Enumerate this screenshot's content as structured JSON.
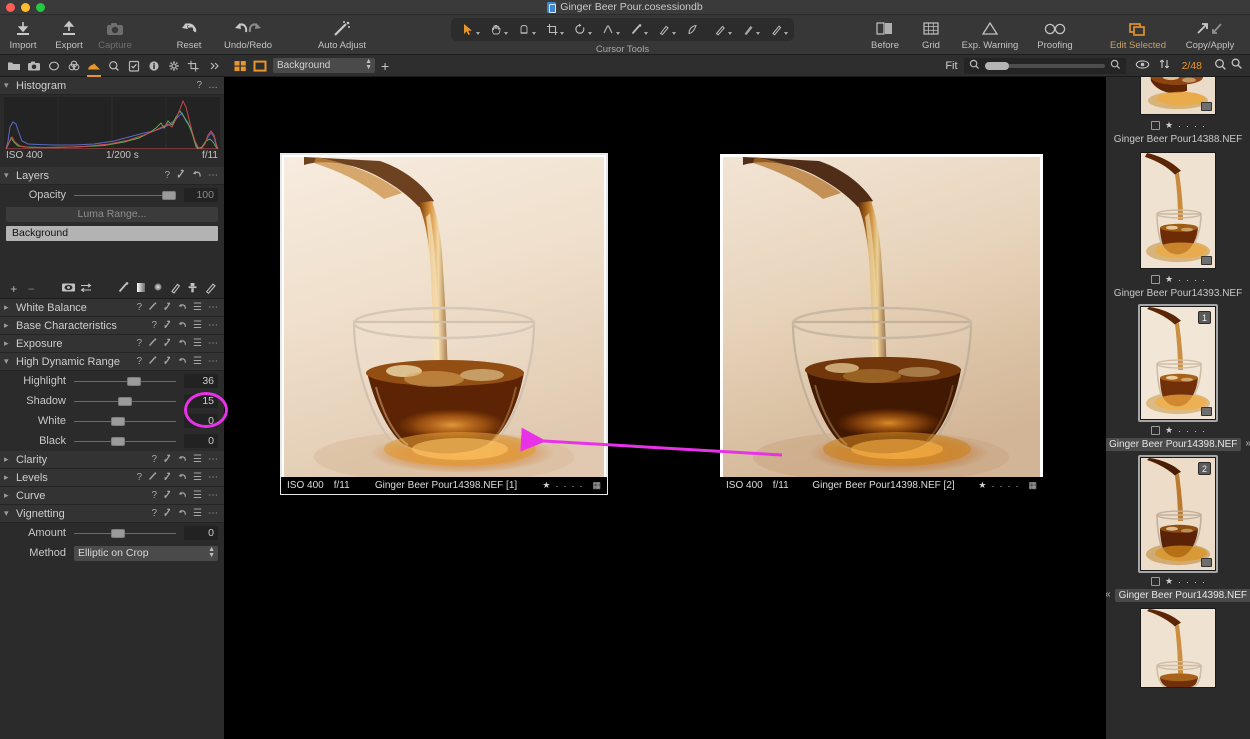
{
  "window": {
    "title": "Ginger Beer Pour.cosessiondb",
    "traffic": [
      "close",
      "minimize",
      "maximize"
    ]
  },
  "toolbar": {
    "left_items": [
      {
        "label": "Import",
        "icon": "import-icon",
        "enabled": true
      },
      {
        "label": "Export",
        "icon": "export-icon",
        "enabled": true
      },
      {
        "label": "Capture",
        "icon": "capture-camera-icon",
        "enabled": false
      }
    ],
    "history_items": [
      {
        "label": "Reset",
        "icon": "reset-icon"
      },
      {
        "label": "Undo/Redo",
        "icon": "undo-redo-icon"
      }
    ],
    "auto_adjust": {
      "label": "Auto Adjust",
      "icon": "magic-wand-icon"
    },
    "cursor_tools": {
      "label": "Cursor Tools",
      "tools": [
        {
          "name": "select-tool",
          "active": true
        },
        {
          "name": "pan-hand-tool",
          "active": false
        },
        {
          "name": "color-picker-tool",
          "active": false
        },
        {
          "name": "crop-tool",
          "active": false
        },
        {
          "name": "rotate-tool",
          "active": false
        },
        {
          "name": "keystone-tool",
          "active": false
        },
        {
          "name": "spot-removal-tool",
          "active": false
        },
        {
          "name": "heal-brush-tool",
          "active": false
        },
        {
          "name": "eraser-tool",
          "active": false
        },
        {
          "name": "draw-mask-tool",
          "active": false
        },
        {
          "name": "gradient-mask-tool",
          "active": false
        },
        {
          "name": "linear-gradient-tool",
          "active": false
        }
      ]
    },
    "right_items": [
      {
        "label": "Before",
        "icon": "before-after-icon"
      },
      {
        "label": "Grid",
        "icon": "grid-icon"
      },
      {
        "label": "Exp. Warning",
        "icon": "exposure-warning-icon"
      },
      {
        "label": "Proofing",
        "icon": "proofing-glasses-icon"
      },
      {
        "label": "Edit Selected",
        "icon": "edit-selected-icon",
        "accent": true
      },
      {
        "label": "Copy/Apply",
        "icon": "copy-apply-icon"
      }
    ]
  },
  "toolbar_colors": {
    "accent_orange": "#e8962c",
    "annotation_magenta": "#e832e8",
    "toolbar_bg": "#373737",
    "panel_bg": "#2b2b2b"
  },
  "secondbar": {
    "tool_tabs": [
      {
        "name": "library-folder-icon",
        "active": false
      },
      {
        "name": "capture-camera-icon",
        "active": false
      },
      {
        "name": "lens-correction-icon",
        "active": false
      },
      {
        "name": "color-icon",
        "active": false
      },
      {
        "name": "exposure-icon",
        "active": true
      },
      {
        "name": "details-loupe-icon",
        "active": false
      },
      {
        "name": "adjustments-clipboard-icon",
        "active": false
      },
      {
        "name": "metadata-info-icon",
        "active": false
      },
      {
        "name": "output-gear-icon",
        "active": false
      },
      {
        "name": "crop-icon",
        "active": false
      },
      {
        "name": "more-chevrons-icon",
        "active": false
      }
    ],
    "view_modes": [
      {
        "name": "multi-view-icon",
        "active": true
      },
      {
        "name": "single-view-icon",
        "active": true
      }
    ],
    "layer_select": "Background",
    "add_layer": "+",
    "zoom_label": "Fit",
    "counter": "2/48",
    "right_icons": [
      {
        "name": "visibility-eye-icon"
      },
      {
        "name": "sort-order-icon"
      },
      {
        "name": "search-icon"
      },
      {
        "name": "zoom-tool-icon"
      }
    ]
  },
  "left_panel": {
    "histogram": {
      "title": "Histogram",
      "help": "?",
      "more": "…",
      "iso": "ISO 400",
      "shutter": "1/200 s",
      "aperture": "f/11"
    },
    "layers": {
      "title": "Layers",
      "opacity_label": "Opacity",
      "opacity_value": "100",
      "luma_range": "Luma Range...",
      "layer_name": "Background",
      "tools": [
        "add-layer-icon",
        "remove-layer-icon",
        "mask-visibility-icon",
        "invert-mask-icon",
        "draw-mask-brush-icon",
        "linear-gradient-icon",
        "radial-gradient-icon",
        "eraser-icon",
        "clone-stamp-icon",
        "heal-brush-icon"
      ]
    },
    "panels": [
      {
        "title": "White Balance",
        "expanded": false,
        "has_picker": true
      },
      {
        "title": "Base Characteristics",
        "expanded": false,
        "has_picker": false
      },
      {
        "title": "Exposure",
        "expanded": false,
        "has_picker": true
      },
      {
        "title": "High Dynamic Range",
        "expanded": true,
        "has_picker": true
      },
      {
        "title": "Clarity",
        "expanded": false,
        "has_picker": false
      },
      {
        "title": "Levels",
        "expanded": false,
        "has_picker": true
      },
      {
        "title": "Curve",
        "expanded": false,
        "has_picker": false
      },
      {
        "title": "Vignetting",
        "expanded": true,
        "has_picker": false
      }
    ],
    "hdr": {
      "sliders": [
        {
          "label": "Highlight",
          "value": "36",
          "pos": 0.52,
          "highlighted": true
        },
        {
          "label": "Shadow",
          "value": "15",
          "pos": 0.43,
          "highlighted": true
        },
        {
          "label": "White",
          "value": "0",
          "pos": 0.36,
          "highlighted": false
        },
        {
          "label": "Black",
          "value": "0",
          "pos": 0.36,
          "highlighted": false
        }
      ]
    },
    "vignetting": {
      "amount_label": "Amount",
      "amount_value": "0",
      "amount_pos": 0.36,
      "method_label": "Method",
      "method_value": "Elliptic on Crop"
    }
  },
  "viewer": {
    "images": [
      {
        "selected": true,
        "iso": "ISO 400",
        "aperture": "f/11",
        "name": "Ginger Beer Pour14398.NEF [1]",
        "rating": 1,
        "stars_total": 5
      },
      {
        "selected": false,
        "iso": "ISO 400",
        "aperture": "f/11",
        "name": "Ginger Beer Pour14398.NEF [2]",
        "rating": 1,
        "stars_total": 5
      }
    ]
  },
  "browser": {
    "thumbnails": [
      {
        "name": "Ginger Beer Pour14388.NEF",
        "badge": null,
        "selected": false,
        "rating": 1,
        "partial_top": true
      },
      {
        "name": "Ginger Beer Pour14393.NEF",
        "badge": null,
        "selected": false,
        "rating": 1
      },
      {
        "name": "Ginger Beer Pour14398.NEF",
        "badge": "1",
        "selected": true,
        "rating": 1,
        "suffix_chevron": "»"
      },
      {
        "name": "Ginger Beer Pour14398.NEF",
        "badge": "2",
        "selected": true,
        "rating": 1,
        "prefix_chevron": "«"
      },
      {
        "name": "",
        "badge": null,
        "selected": false,
        "rating": 0,
        "partial_bottom": true
      }
    ]
  },
  "annotations": {
    "circle": {
      "target": "hdr-highlight-shadow-values",
      "color": "#e832e8"
    },
    "arrow": {
      "from": "right-image",
      "to": "left-image",
      "color": "#e832e8"
    }
  }
}
